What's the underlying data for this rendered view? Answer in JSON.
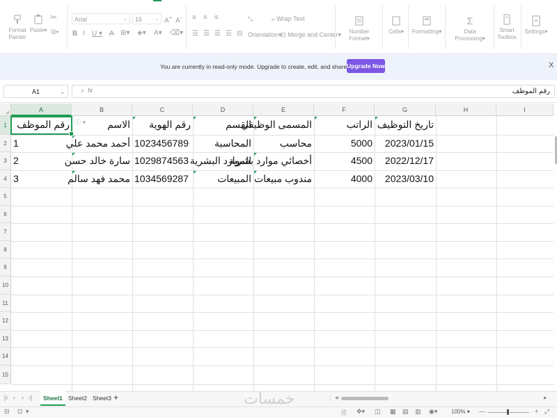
{
  "ribbon": {
    "format_painter": "Format Painter",
    "paste": "Paste",
    "font_name": "Arial",
    "font_size": "16",
    "wrap_text": "Wrap Text",
    "orientation": "Orientation",
    "merge_center": "Merge and Center",
    "number_format": "Number Format",
    "cells": "Cells",
    "formatting": "Formatting",
    "data_processing": "Data Processing",
    "smart_toolbox": "Smart Toolbox",
    "settings": "Settings"
  },
  "banner": {
    "message": "You are currently in read-only mode. Upgrade to create, edit, and share documents.",
    "upgrade_label": "Upgrade Now",
    "close": "X"
  },
  "formula_bar": {
    "cell_ref": "A1",
    "fx": "fx",
    "content": "رقم الموظف"
  },
  "columns": [
    "A",
    "B",
    "C",
    "D",
    "E",
    "F",
    "G",
    "H",
    "I"
  ],
  "rows": [
    "1",
    "2",
    "3",
    "4",
    "5",
    "6",
    "7",
    "8",
    "9",
    "10",
    "11",
    "12",
    "13",
    "14",
    "15"
  ],
  "table": {
    "headers": [
      "رقم الموظف",
      "الاسم",
      "رقم الهوية",
      "القسم",
      "المسمى الوظيفي",
      "الراتب",
      "تاريخ التوظيف"
    ],
    "data": [
      [
        "1",
        "أحمد محمد علي",
        "1023456789",
        "المحاسبة",
        "محاسب",
        "5000",
        "2023/01/15"
      ],
      [
        "2",
        "سارة خالد حسن",
        "1029874563",
        "الموارد البشرية",
        "أخصائي موارد بشرية",
        "4500",
        "2022/12/17"
      ],
      [
        "3",
        "محمد فهد سالم",
        "1034569287",
        "المبيعات",
        "مندوب مبيعات",
        "4000",
        "2023/03/10"
      ]
    ]
  },
  "sheets": [
    "Sheet1",
    "Sheet2",
    "Sheet3"
  ],
  "active_sheet": "Sheet1",
  "watermark": "خمسات",
  "status": {
    "zoom": "100%"
  },
  "colors": {
    "accent_green": "#1e9b53",
    "upgrade_purple": "#7b57e4",
    "banner_bg": "#eef2fb"
  }
}
